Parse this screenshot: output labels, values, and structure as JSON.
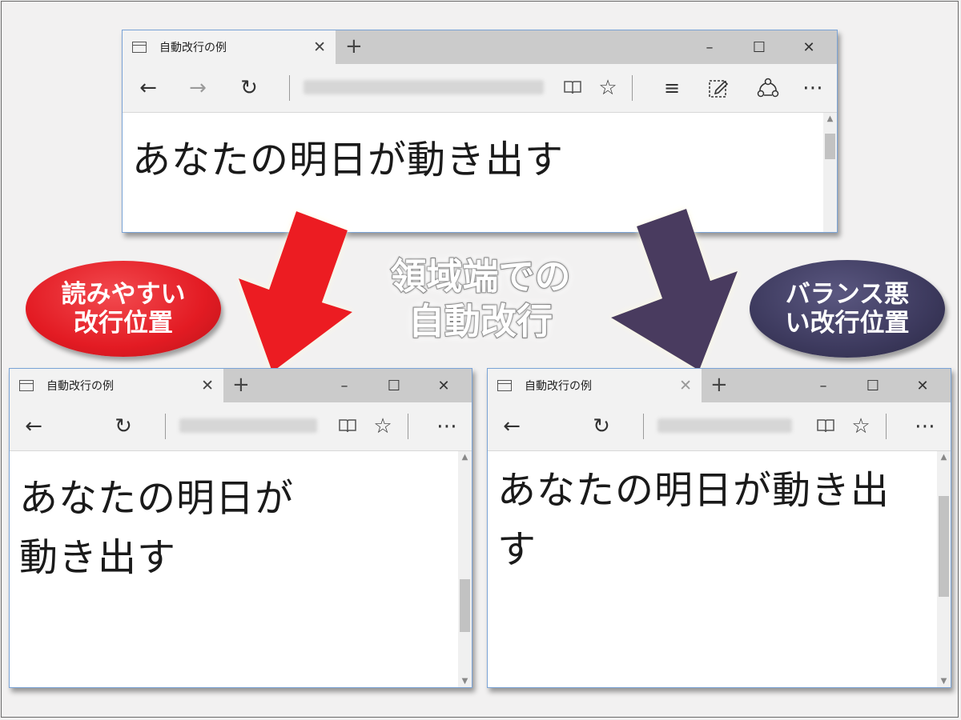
{
  "browsers": [
    {
      "tab_title": "自動改行の例",
      "tab_close": "✕",
      "new_tab": "+",
      "window_controls": {
        "minimize": "–",
        "maximize": "☐",
        "close": "✕"
      },
      "toolbar": {
        "back": "←",
        "forward": "→",
        "refresh": "↻",
        "reading_view": "reading-view-icon",
        "favorite": "☆",
        "hub": "≡",
        "web_note": "web-note-icon",
        "share": "share-icon",
        "more": "⋯"
      },
      "page_lines": [
        "あなたの明日が動き出す"
      ]
    },
    {
      "tab_title": "自動改行の例",
      "tab_close": "✕",
      "new_tab": "+",
      "window_controls": {
        "minimize": "–",
        "maximize": "☐",
        "close": "✕"
      },
      "toolbar": {
        "back": "←",
        "refresh": "↻",
        "favorite": "☆",
        "more": "⋯"
      },
      "page_lines": [
        "あなたの明日が",
        "動き出す"
      ]
    },
    {
      "tab_title": "自動改行の例",
      "tab_close": "✕",
      "new_tab": "+",
      "window_controls": {
        "minimize": "–",
        "maximize": "☐",
        "close": "✕"
      },
      "toolbar": {
        "back": "←",
        "refresh": "↻",
        "favorite": "☆",
        "more": "⋯"
      },
      "page_lines": [
        "あなたの明日が動き出",
        "す"
      ]
    }
  ],
  "caption": {
    "line1": "領域端での",
    "line2": "自動改行"
  },
  "badge_left": {
    "line1": "読みやすい",
    "line2": "改行位置",
    "color": "#e31b23"
  },
  "badge_right": {
    "line1": "バランス悪",
    "line2": "い改行位置",
    "color": "#3d3a5e"
  },
  "arrow_colors": {
    "left": "#ec1c24",
    "right": "#4a3b5e"
  }
}
